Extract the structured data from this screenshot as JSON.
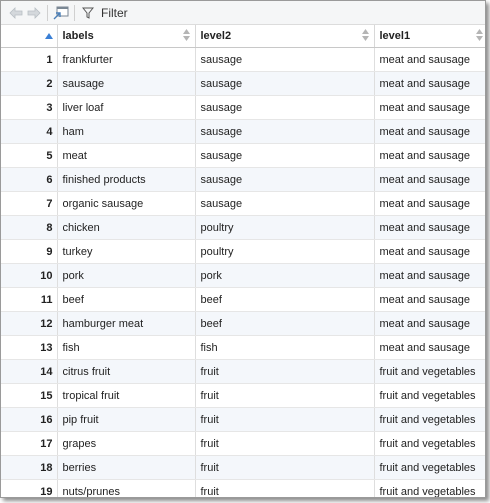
{
  "toolbar": {
    "filter_label": "Filter",
    "icons": [
      "back-arrow-icon",
      "forward-arrow-icon",
      "popout-icon",
      "filter-icon"
    ]
  },
  "table": {
    "index_header": "",
    "columns": [
      "labels",
      "level2",
      "level1"
    ],
    "rows": [
      {
        "idx": "1",
        "labels": "frankfurter",
        "level2": "sausage",
        "level1": "meat and sausage"
      },
      {
        "idx": "2",
        "labels": "sausage",
        "level2": "sausage",
        "level1": "meat and sausage"
      },
      {
        "idx": "3",
        "labels": "liver loaf",
        "level2": "sausage",
        "level1": "meat and sausage"
      },
      {
        "idx": "4",
        "labels": "ham",
        "level2": "sausage",
        "level1": "meat and sausage"
      },
      {
        "idx": "5",
        "labels": "meat",
        "level2": "sausage",
        "level1": "meat and sausage"
      },
      {
        "idx": "6",
        "labels": "finished products",
        "level2": "sausage",
        "level1": "meat and sausage"
      },
      {
        "idx": "7",
        "labels": "organic sausage",
        "level2": "sausage",
        "level1": "meat and sausage"
      },
      {
        "idx": "8",
        "labels": "chicken",
        "level2": "poultry",
        "level1": "meat and sausage"
      },
      {
        "idx": "9",
        "labels": "turkey",
        "level2": "poultry",
        "level1": "meat and sausage"
      },
      {
        "idx": "10",
        "labels": "pork",
        "level2": "pork",
        "level1": "meat and sausage"
      },
      {
        "idx": "11",
        "labels": "beef",
        "level2": "beef",
        "level1": "meat and sausage"
      },
      {
        "idx": "12",
        "labels": "hamburger meat",
        "level2": "beef",
        "level1": "meat and sausage"
      },
      {
        "idx": "13",
        "labels": "fish",
        "level2": "fish",
        "level1": "meat and sausage"
      },
      {
        "idx": "14",
        "labels": "citrus fruit",
        "level2": "fruit",
        "level1": "fruit and vegetables"
      },
      {
        "idx": "15",
        "labels": "tropical fruit",
        "level2": "fruit",
        "level1": "fruit and vegetables"
      },
      {
        "idx": "16",
        "labels": "pip fruit",
        "level2": "fruit",
        "level1": "fruit and vegetables"
      },
      {
        "idx": "17",
        "labels": "grapes",
        "level2": "fruit",
        "level1": "fruit and vegetables"
      },
      {
        "idx": "18",
        "labels": "berries",
        "level2": "fruit",
        "level1": "fruit and vegetables"
      },
      {
        "idx": "19",
        "labels": "nuts/prunes",
        "level2": "fruit",
        "level1": "fruit and vegetables"
      }
    ]
  },
  "colors": {
    "alt_row": "#f4f7fb",
    "sort_active": "#3a7fd5",
    "sort_inactive": "#b5b5b5"
  }
}
